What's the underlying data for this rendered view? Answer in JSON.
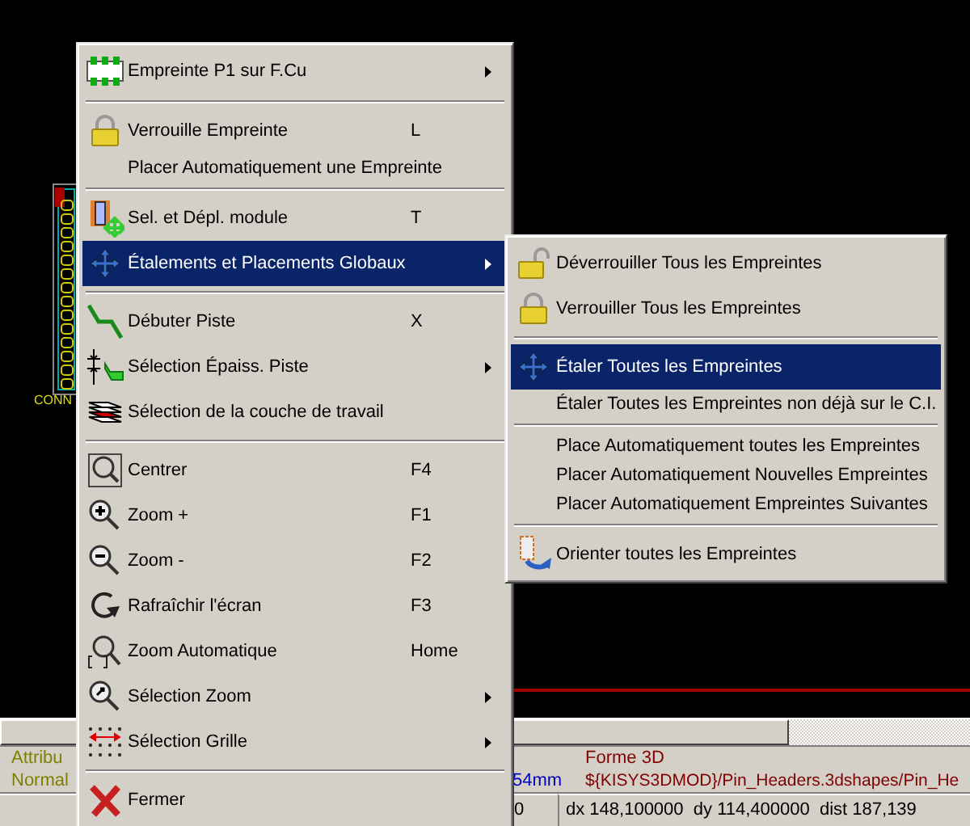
{
  "canvas": {
    "component_label": "CONN"
  },
  "context_menu": {
    "items": [
      {
        "kind": "item",
        "label": "Empreinte P1 sur F.Cu",
        "submenu": true,
        "selected": false
      },
      {
        "kind": "separator"
      },
      {
        "kind": "item",
        "label": "Verrouille Empreinte",
        "shortcut": "L",
        "submenu": false,
        "selected": false
      },
      {
        "kind": "item",
        "label": "Placer Automatiquement une Empreinte",
        "submenu": false,
        "selected": false
      },
      {
        "kind": "separator"
      },
      {
        "kind": "item",
        "label": "Sel. et Dépl. module",
        "shortcut": "T",
        "submenu": false,
        "selected": false
      },
      {
        "kind": "item",
        "label": "Étalements et Placements Globaux",
        "submenu": true,
        "selected": true
      },
      {
        "kind": "separator"
      },
      {
        "kind": "item",
        "label": "Débuter Piste",
        "shortcut": "X",
        "submenu": false,
        "selected": false
      },
      {
        "kind": "item",
        "label": "Sélection Épaiss. Piste",
        "submenu": true,
        "selected": false
      },
      {
        "kind": "item",
        "label": "Sélection de la couche de travail",
        "submenu": false,
        "selected": false
      },
      {
        "kind": "separator"
      },
      {
        "kind": "item",
        "label": "Centrer",
        "shortcut": "F4",
        "submenu": false,
        "selected": false
      },
      {
        "kind": "item",
        "label": "Zoom +",
        "shortcut": "F1",
        "submenu": false,
        "selected": false
      },
      {
        "kind": "item",
        "label": "Zoom -",
        "shortcut": "F2",
        "submenu": false,
        "selected": false
      },
      {
        "kind": "item",
        "label": "Rafraîchir l'écran",
        "shortcut": "F3",
        "submenu": false,
        "selected": false
      },
      {
        "kind": "item",
        "label": "Zoom Automatique",
        "shortcut": "Home",
        "submenu": false,
        "selected": false
      },
      {
        "kind": "item",
        "label": "Sélection Zoom",
        "submenu": true,
        "selected": false
      },
      {
        "kind": "item",
        "label": "Sélection Grille",
        "submenu": true,
        "selected": false
      },
      {
        "kind": "separator"
      },
      {
        "kind": "item",
        "label": "Fermer",
        "submenu": false,
        "selected": false
      }
    ]
  },
  "submenu": {
    "items": [
      {
        "kind": "item",
        "label": "Déverrouiller Tous les Empreintes",
        "selected": false
      },
      {
        "kind": "item",
        "label": "Verrouiller Tous les Empreintes",
        "selected": false
      },
      {
        "kind": "separator"
      },
      {
        "kind": "item",
        "label": "Étaler Toutes les Empreintes",
        "selected": true
      },
      {
        "kind": "item",
        "label": "Étaler Toutes les Empreintes non déjà sur le C.I.",
        "selected": false
      },
      {
        "kind": "separator"
      },
      {
        "kind": "item",
        "label": "Place Automatiquement toutes les Empreintes",
        "selected": false
      },
      {
        "kind": "item",
        "label": "Placer Automatiquement Nouvelles Empreintes",
        "selected": false
      },
      {
        "kind": "item",
        "label": "Placer Automatiquement Empreintes Suivantes",
        "selected": false
      },
      {
        "kind": "separator"
      },
      {
        "kind": "item",
        "label": "Orienter toutes les Empreintes",
        "selected": false
      }
    ]
  },
  "message_panel": {
    "columns": [
      {
        "title": "Attribu",
        "value": "Normal",
        "color": "#808000"
      },
      {
        "value": "54mm",
        "color": "#0000c0"
      },
      {
        "title": "Forme 3D",
        "value": "${KISYS3DMOD}/Pin_Headers.3dshapes/Pin_He",
        "color": "#800000"
      }
    ]
  },
  "status_bar": {
    "fields": [
      "0",
      "dx 148,100000  dy 114,400000  dist 187,139"
    ]
  }
}
